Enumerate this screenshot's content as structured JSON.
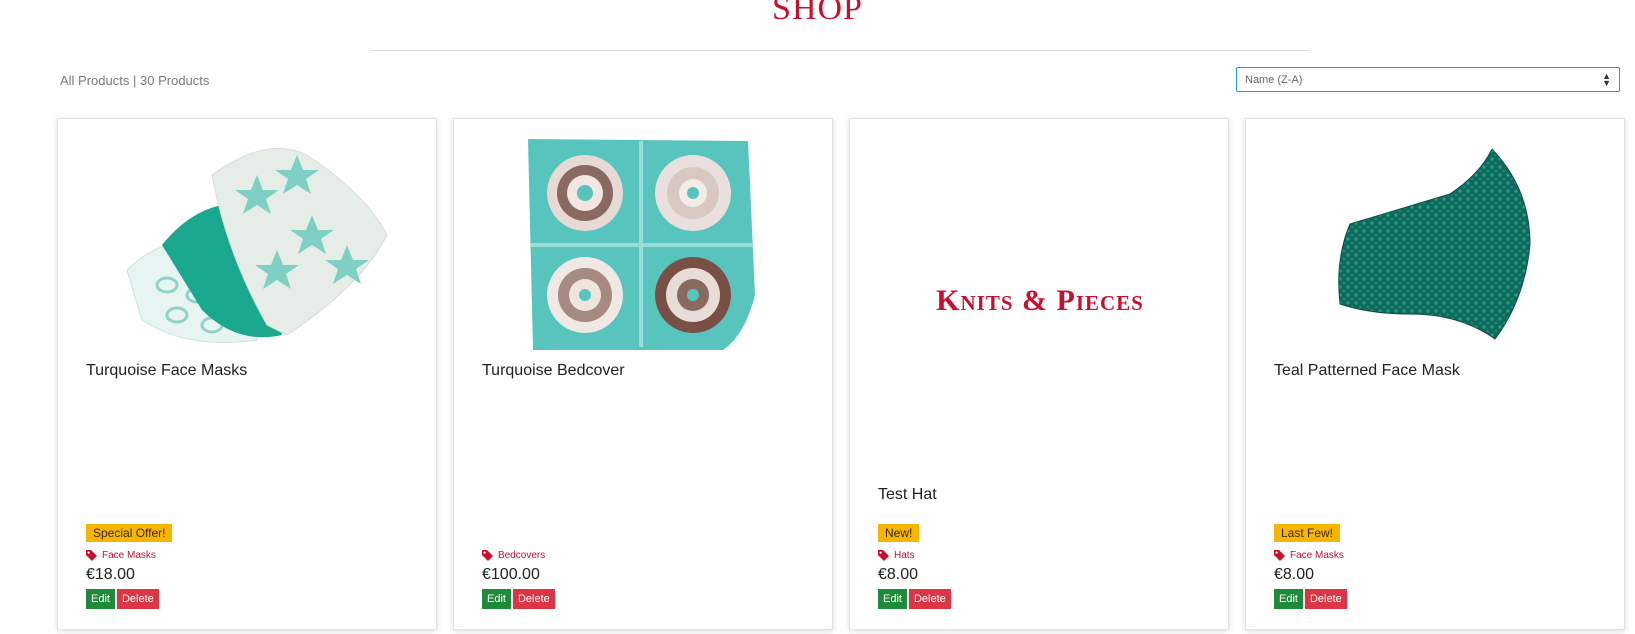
{
  "header": {
    "title": "SHOP"
  },
  "toolbar": {
    "filter_label": "All Products",
    "separator": "|",
    "count_label": "30 Products",
    "sort_selected": "Name (Z-A)"
  },
  "products": [
    {
      "name": "Turquoise Face Masks",
      "badge": "Special Offer!",
      "category": "Face Masks",
      "price": "€18.00",
      "edit_label": "Edit",
      "delete_label": "Delete"
    },
    {
      "name": "Turquoise Bedcover",
      "badge": "",
      "category": "Bedcovers",
      "price": "€100.00",
      "edit_label": "Edit",
      "delete_label": "Delete"
    },
    {
      "name": "Test Hat",
      "badge": "New!",
      "category": "Hats",
      "price": "€8.00",
      "edit_label": "Edit",
      "delete_label": "Delete",
      "image_logo_text": "Knits & Pieces"
    },
    {
      "name": "Teal Patterned Face Mask",
      "badge": "Last Few!",
      "category": "Face Masks",
      "price": "€8.00",
      "edit_label": "Edit",
      "delete_label": "Delete"
    }
  ],
  "colors": {
    "brand": "#c8102e",
    "badge": "#f7b500",
    "edit": "#1e8a3a",
    "delete": "#dc3545",
    "teal": "#3fbfb5"
  },
  "icons": {
    "category": "tag-icon",
    "sort": "sort-arrows-icon"
  }
}
